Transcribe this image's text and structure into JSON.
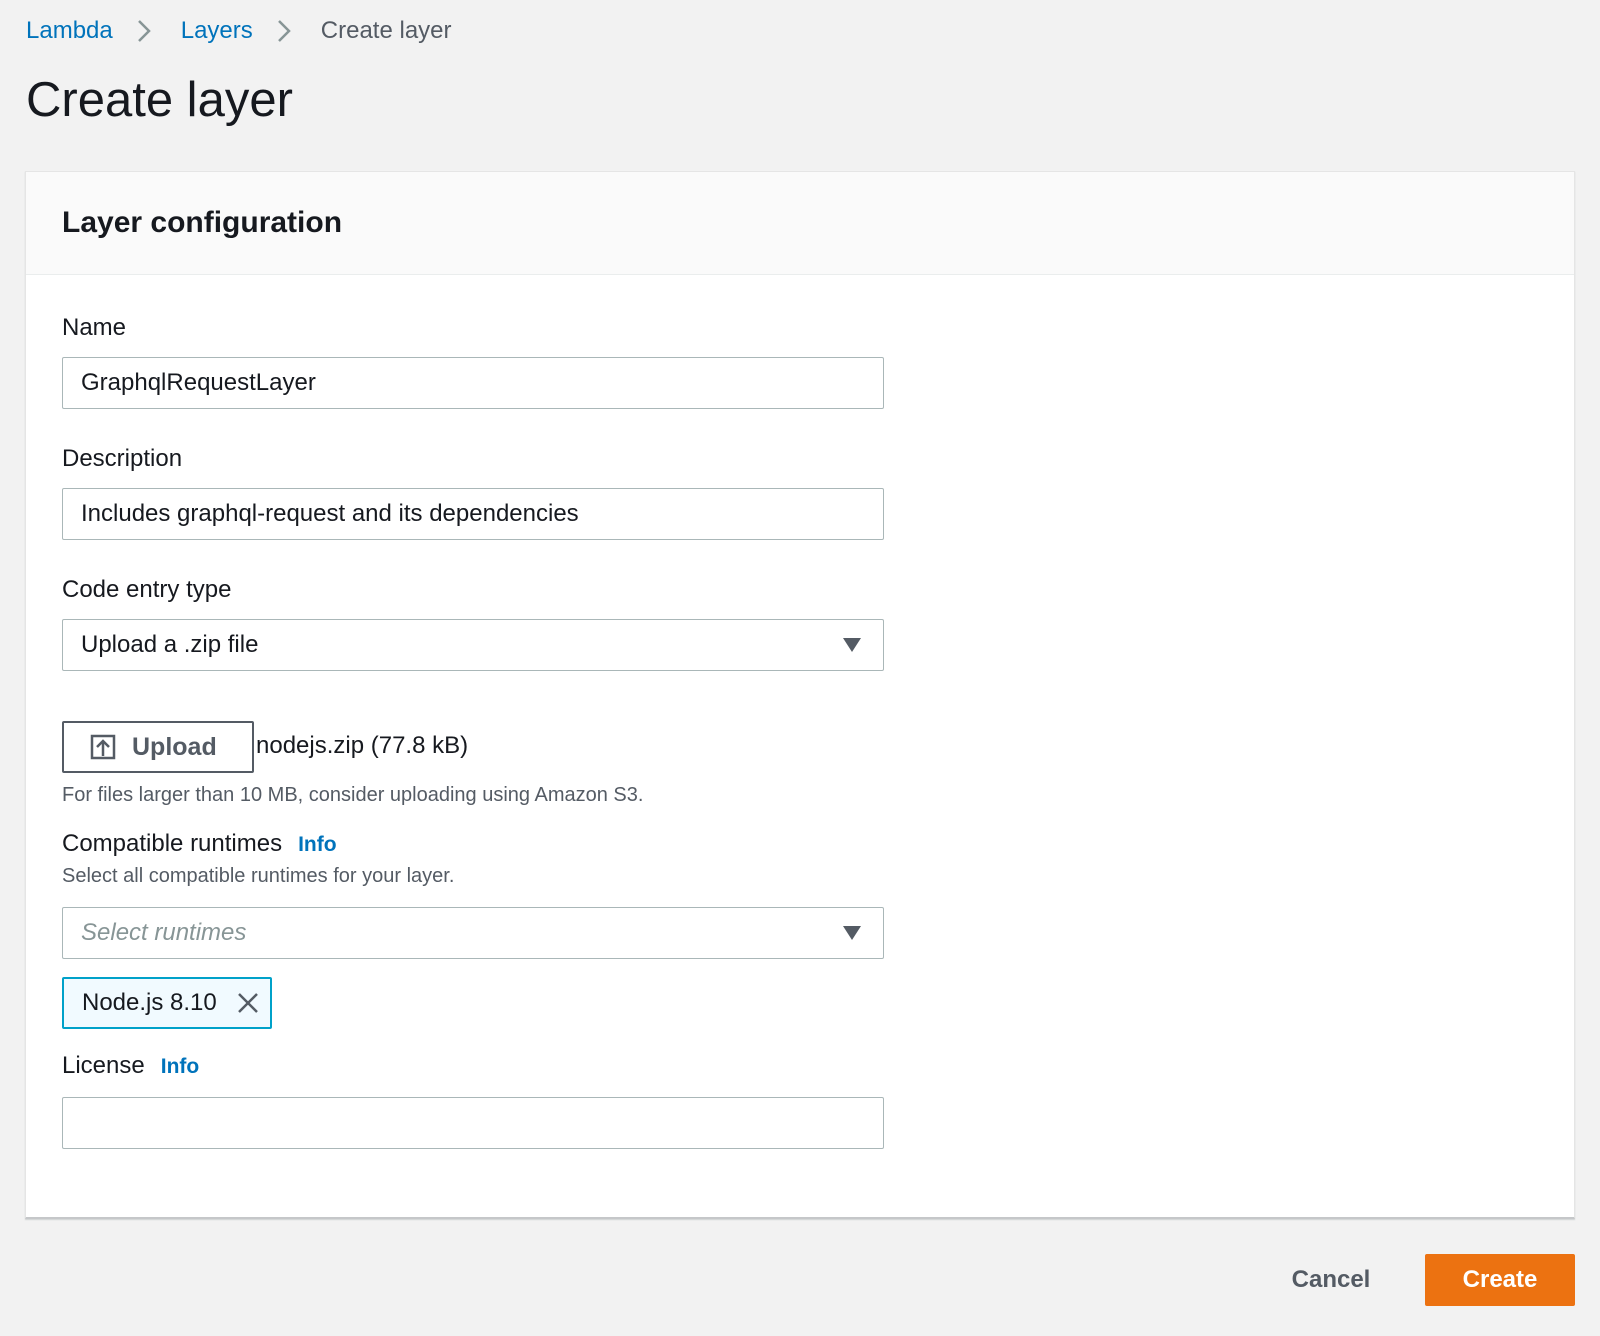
{
  "breadcrumb": {
    "items": [
      {
        "label": "Lambda"
      },
      {
        "label": "Layers"
      },
      {
        "label": "Create layer"
      }
    ]
  },
  "page": {
    "title": "Create layer"
  },
  "panel": {
    "title": "Layer configuration"
  },
  "form": {
    "name": {
      "label": "Name",
      "value": "GraphqlRequestLayer"
    },
    "description": {
      "label": "Description",
      "value": "Includes graphql-request and its dependencies"
    },
    "code_entry_type": {
      "label": "Code entry type",
      "selected": "Upload a .zip file"
    },
    "upload": {
      "button_label": "Upload",
      "file_name": "nodejs.zip (77.8 kB)",
      "hint": "For files larger than 10 MB, consider uploading using Amazon S3."
    },
    "runtimes": {
      "label": "Compatible runtimes",
      "info": "Info",
      "description": "Select all compatible runtimes for your layer.",
      "placeholder": "Select runtimes",
      "selected": [
        {
          "label": "Node.js 8.10"
        }
      ]
    },
    "license": {
      "label": "License",
      "info": "Info",
      "value": ""
    }
  },
  "actions": {
    "cancel_label": "Cancel",
    "create_label": "Create"
  },
  "colors": {
    "link": "#0073bb",
    "primary_button": "#ec7211",
    "token_border": "#00a1c9",
    "token_background": "#f1faff",
    "page_background": "#f2f2f2"
  },
  "icons": {
    "breadcrumb_separator": "chevron-right-icon",
    "upload": "upload-icon",
    "dropdown": "caret-down-icon",
    "token_dismiss": "close-icon"
  }
}
